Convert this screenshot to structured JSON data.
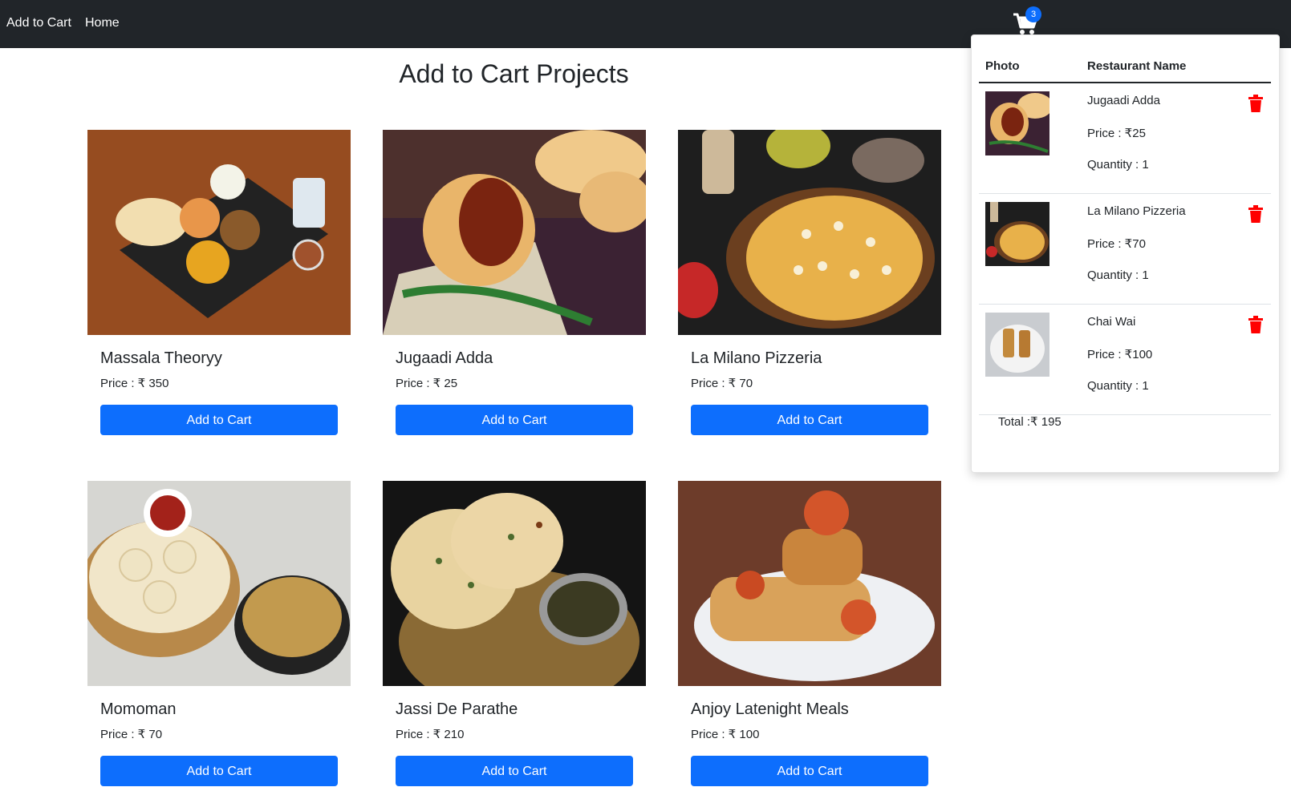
{
  "navbar": {
    "brand": "Add to Cart",
    "home": "Home",
    "cart_count": "3"
  },
  "page": {
    "title": "Add to Cart Projects"
  },
  "products": [
    {
      "name": "Massala Theoryy",
      "price": "Price : ₹ 350",
      "button": "Add to Cart"
    },
    {
      "name": "Jugaadi Adda",
      "price": "Price : ₹ 25",
      "button": "Add to Cart"
    },
    {
      "name": "La Milano Pizzeria",
      "price": "Price : ₹ 70",
      "button": "Add to Cart"
    },
    {
      "name": "Momoman",
      "price": "Price : ₹ 70",
      "button": "Add to Cart"
    },
    {
      "name": "Jassi De Parathe",
      "price": "Price : ₹ 210",
      "button": "Add to Cart"
    },
    {
      "name": "Anjoy Latenight Meals",
      "price": "Price : ₹ 100",
      "button": "Add to Cart"
    }
  ],
  "cart": {
    "headers": {
      "photo": "Photo",
      "name": "Restaurant Name"
    },
    "items": [
      {
        "name": "Jugaadi Adda",
        "price": "Price : ₹25",
        "quantity": "Quantity : 1"
      },
      {
        "name": "La Milano Pizzeria",
        "price": "Price : ₹70",
        "quantity": "Quantity : 1"
      },
      {
        "name": "Chai Wai",
        "price": "Price : ₹100",
        "quantity": "Quantity : 1"
      }
    ],
    "total": "Total :₹ 195"
  },
  "colors": {
    "navbar": "#212529",
    "primary": "#0d6efd",
    "delete": "#ff0000"
  }
}
